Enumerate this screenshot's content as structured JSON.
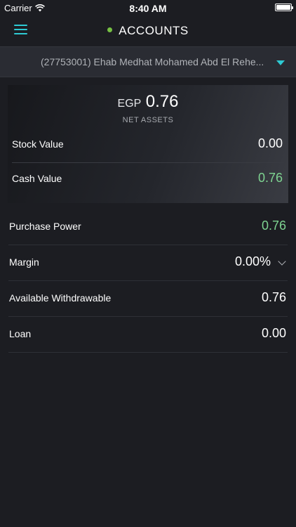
{
  "status_bar": {
    "carrier": "Carrier",
    "time": "8:40 AM"
  },
  "header": {
    "title": "ACCOUNTS"
  },
  "account_selector": {
    "value": "(27753001) Ehab Medhat Mohamed Abd El Rehe..."
  },
  "summary": {
    "currency": "EGP",
    "net_assets": "0.76",
    "net_assets_label": "NET ASSETS",
    "rows": [
      {
        "label": "Stock Value",
        "value": "0.00"
      },
      {
        "label": "Cash Value",
        "value": "0.76"
      }
    ]
  },
  "details": [
    {
      "label": "Purchase Power",
      "value": "0.76"
    },
    {
      "label": "Margin",
      "value": "0.00%"
    },
    {
      "label": "Available Withdrawable",
      "value": "0.76"
    },
    {
      "label": "Loan",
      "value": "0.00"
    }
  ],
  "colors": {
    "accent": "#2ecad3",
    "positive": "#7ed491",
    "status_dot": "#76c043",
    "background": "#1c1d22"
  }
}
